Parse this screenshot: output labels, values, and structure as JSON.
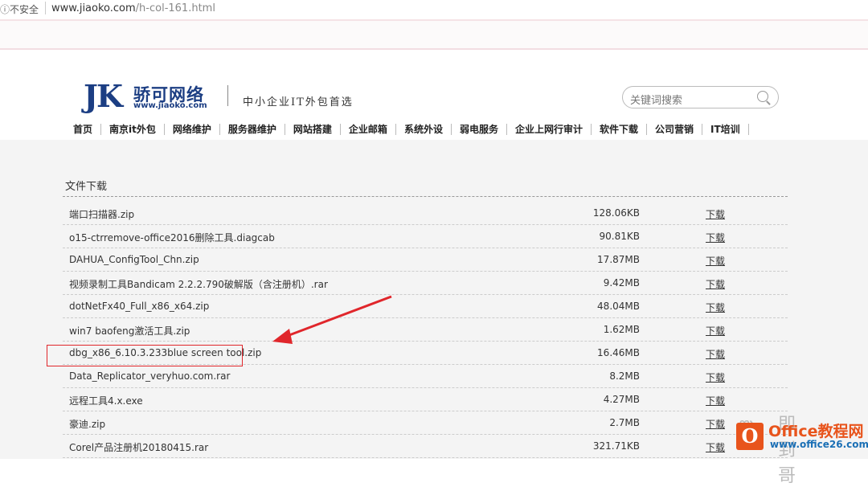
{
  "browser": {
    "security_label": "不安全",
    "url_host": "www.jiaoko.com",
    "url_path": "/h-col-161.html"
  },
  "header": {
    "logo_letters": "JK",
    "logo_name": "骄可网络",
    "logo_url": "www.jiaoko.com",
    "slogan": "中小企业IT外包首选",
    "search_placeholder": "关键词搜索"
  },
  "nav": [
    "首页",
    "南京it外包",
    "网络维护",
    "服务器维护",
    "网站搭建",
    "企业邮箱",
    "系统外设",
    "弱电服务",
    "企业上网行审计",
    "软件下载",
    "公司营销",
    "IT培训"
  ],
  "downloads": {
    "title": "文件下载",
    "rows": [
      {
        "name": "端口扫描器.zip",
        "size": "128.06KB",
        "action": "下载"
      },
      {
        "name": "o15-ctrremove-office2016删除工具.diagcab",
        "size": "90.81KB",
        "action": "下载"
      },
      {
        "name": "DAHUA_ConfigTool_Chn.zip",
        "size": "17.87MB",
        "action": "下载"
      },
      {
        "name": "视频录制工具Bandicam 2.2.2.790破解版（含注册机）.rar",
        "size": "9.42MB",
        "action": "下载"
      },
      {
        "name": "dotNetFx40_Full_x86_x64.zip",
        "size": "48.04MB",
        "action": "下载"
      },
      {
        "name": "win7 baofeng激活工具.zip",
        "size": "1.62MB",
        "action": "下载"
      },
      {
        "name": "dbg_x86_6.10.3.233blue screen tool.zip",
        "size": "16.46MB",
        "action": "下载"
      },
      {
        "name": "Data_Replicator_veryhuo.com.rar",
        "size": "8.2MB",
        "action": "下载"
      },
      {
        "name": "远程工具4.x.exe",
        "size": "4.27MB",
        "action": "下载"
      },
      {
        "name": "豪迪.zip",
        "size": "2.7MB",
        "action": "下载"
      },
      {
        "name": "Corel产品注册机20180415.rar",
        "size": "321.71KB",
        "action": "下载"
      }
    ]
  },
  "watermark": {
    "author": "即到哥",
    "brand": "Office教程网",
    "site": "www.office26.com",
    "logo_letter": "O"
  },
  "colors": {
    "logo_blue": "#1c3e83",
    "highlight_red": "#e0262b",
    "office_orange": "#e8541c"
  }
}
